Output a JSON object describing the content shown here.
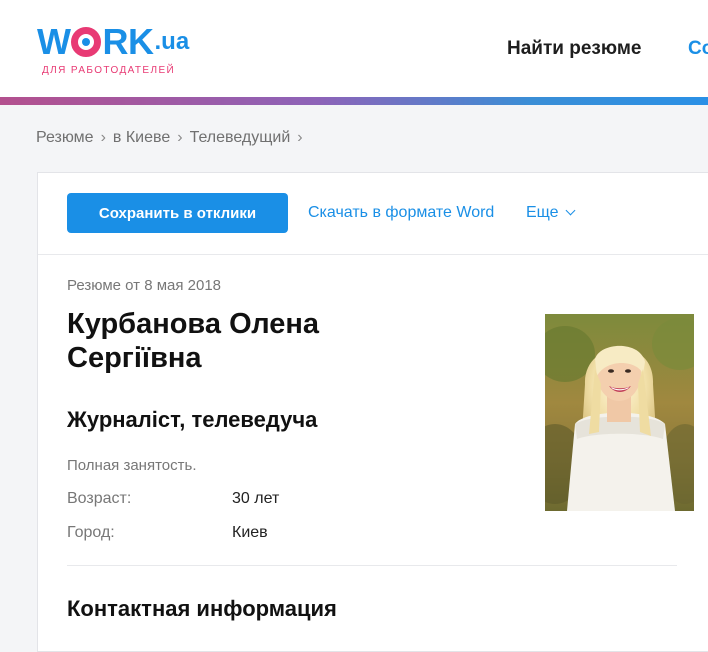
{
  "header": {
    "logo_word_pre": "W",
    "logo_word_post": "RK",
    "logo_suffix": ".ua",
    "logo_subtitle": "ДЛЯ РАБОТОДАТЕЛЕЙ",
    "nav_find_resume": "Найти резюме",
    "nav_next_partial": "Со"
  },
  "breadcrumb": {
    "items": [
      "Резюме",
      "в Киеве",
      "Телеведущий"
    ],
    "separator": "›"
  },
  "toolbar": {
    "save_label": "Сохранить в отклики",
    "download_label": "Скачать в формате Word",
    "more_label": "Еще"
  },
  "resume": {
    "date": "Резюме от 8 мая 2018",
    "name_line1": "Курбанова Олена",
    "name_line2": "Сергіївна",
    "position": "Журналіст, телеведуча",
    "employment": "Полная занятость.",
    "age_label": "Возраст:",
    "age_value": "30 лет",
    "city_label": "Город:",
    "city_value": "Киев",
    "contacts_title": "Контактная информация"
  },
  "colors": {
    "brand_blue": "#1a8fe6",
    "brand_pink": "#e83a74",
    "page_background": "#f4f5f7"
  },
  "icons": {
    "more_chevron": "chevron-down-icon",
    "breadcrumb_separator": "chevron-right-icon"
  }
}
